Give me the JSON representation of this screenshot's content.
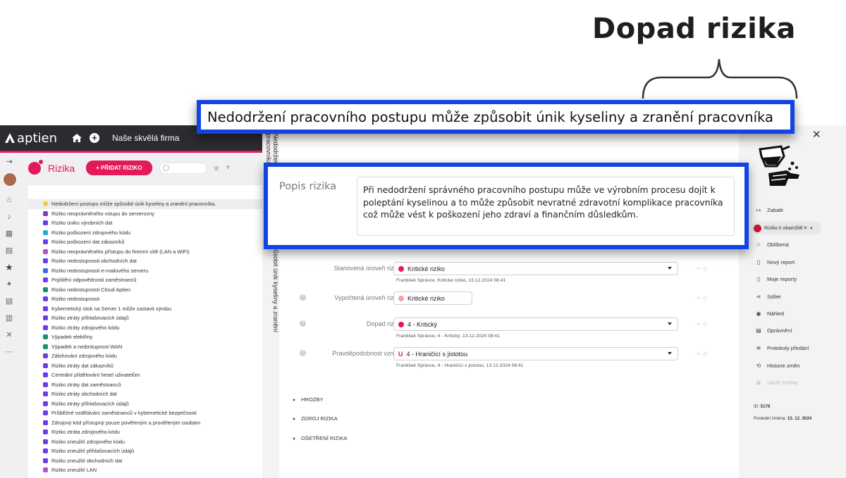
{
  "headline": "Dopad rizika",
  "callout_title": "Nedodržení pracovního postupu může způsobit únik kyseliny a zranění pracovníka",
  "description": {
    "label": "Popis rizika",
    "text": "Při nedodržení správného pracovního postupu může ve výrobním procesu dojít k poleptání kyselinou a to může způsobit nevratné zdravotní komplikace pracovníka což může vést k poškození jeho zdraví a finančním důsledkům."
  },
  "app": {
    "logo_text": "aptien",
    "company": "Naše skvělá firma",
    "section_title": "Rizika",
    "add_button": "+ PŘIDAT RIZIKO",
    "accent": "#e3195a"
  },
  "risk_list": [
    {
      "label": "Nedodržení postupu může způsobit únik kyseliny a zranění pracovníka.",
      "color": "#f5c542",
      "active": true
    },
    {
      "label": "Riziko neoprávněného vstupu do serverovny",
      "color": "#8a3ab9"
    },
    {
      "label": "Riziko úniku výrobních dat",
      "color": "#6a3de8"
    },
    {
      "label": "Riziko poškození zdrojového kódu",
      "color": "#2aa7d6"
    },
    {
      "label": "Riziko poškození dat zákazníků",
      "color": "#6a3de8"
    },
    {
      "label": "Riziko neoprávněného přístupu do firemní sítě (LAN a WiFi)",
      "color": "#b14fd6"
    },
    {
      "label": "Riziko nedostupnosti obchodních dat",
      "color": "#6a3de8"
    },
    {
      "label": "Riziko nedostupnosti e-mailového serveru",
      "color": "#3b6fd8"
    },
    {
      "label": "Pojištění odpovědnosti zaměstnanců",
      "color": "#6a3de8"
    },
    {
      "label": "Riziko nedostupnosti Cloud Aptien",
      "color": "#1a8f6f"
    },
    {
      "label": "Riziko nedostupnosti",
      "color": "#6a3de8"
    },
    {
      "label": "Kybernetický útok na Server 1 může zastavit výrobu",
      "color": "#6a3de8"
    },
    {
      "label": "Riziko ztráty přihlašovacích údajů",
      "color": "#6a3de8"
    },
    {
      "label": "Riziko ztráty zdrojového kódu",
      "color": "#6a3de8"
    },
    {
      "label": "Výpadek elektřiny",
      "color": "#1a8f6f"
    },
    {
      "label": "Výpadek a nedostupnost WAN",
      "color": "#1a8f6f"
    },
    {
      "label": "Zálohování zdrojového kódu",
      "color": "#6a3de8"
    },
    {
      "label": "Riziko ztráty dat zákazníků",
      "color": "#6a3de8"
    },
    {
      "label": "Centrální přidělování hesel uživatelům",
      "color": "#6a3de8"
    },
    {
      "label": "Riziko ztráty dat zaměstnanců",
      "color": "#6a3de8"
    },
    {
      "label": "Riziko ztráty obchodních dat",
      "color": "#6a3de8"
    },
    {
      "label": "Riziko ztráty přihlašovacích údajů",
      "color": "#6a3de8"
    },
    {
      "label": "Průběžné vzdělávání zaměstnanců v kybernetické bezpečnosti",
      "color": "#6a3de8"
    },
    {
      "label": "Zdrojový kód přístupný pouze pověřeným a prověřeným osobám",
      "color": "#6a3de8"
    },
    {
      "label": "Riziko ztráta zdrojového kódu",
      "color": "#6a3de8"
    },
    {
      "label": "Riziko zneužití zdrojového kódu",
      "color": "#6a3de8"
    },
    {
      "label": "Riziko zneužití přihlašovacích údajů",
      "color": "#6a3de8"
    },
    {
      "label": "Riziko zneužití obchodních dat",
      "color": "#6a3de8"
    },
    {
      "label": "Riziko zneužití LAN",
      "color": "#b14fd6"
    }
  ],
  "detail": {
    "vertical_title": "Nedodržení pracovního postupu může způsobit únik kyseliny a zranění pracovníka.",
    "fields": [
      {
        "label": "Stanovená úroveň rizika",
        "value": "Kritické riziko",
        "dot": "#e3195a",
        "meta": "František Správce, Kritické riziko, 13.12.2024 08:41",
        "help": false,
        "select": true
      },
      {
        "label": "Vypočtená úroveň rizika",
        "value": "Kritické riziko",
        "dot": "#f2a3a8",
        "meta": "",
        "help": true,
        "select": false
      },
      {
        "label": "Dopad rizika",
        "value": "4 - Kritický",
        "dot": "#e3195a",
        "meta": "František Správce, 4 - Kritický, 13.12.2024 08:41",
        "help": true,
        "select": true
      },
      {
        "label": "Pravděpodobnost vzniku",
        "value": "4 - Hraničící s jistotou",
        "dot": "magnet",
        "meta": "František Správce, 4 - Hraničící s jistotou, 13.12.2024 08:41",
        "help": true,
        "select": true
      }
    ],
    "sections": [
      "HROZBY",
      "ZDROJ RIZIKA",
      "OŠETŘENÍ RIZIKA"
    ]
  },
  "actions": {
    "collapse": "Zabalit",
    "status_pill": "Riziko k okamžitě",
    "items": [
      {
        "label": "Oblíbená",
        "icon": "star-outline-icon",
        "disabled": false
      },
      {
        "label": "Nový report",
        "icon": "report-icon",
        "disabled": false
      },
      {
        "label": "Moje reporty",
        "icon": "reports-icon",
        "disabled": false
      },
      {
        "label": "Sdílet",
        "icon": "share-icon",
        "disabled": false
      },
      {
        "label": "Náhled",
        "icon": "eye-icon",
        "disabled": false
      },
      {
        "label": "Oprávnění",
        "icon": "permissions-icon",
        "disabled": false
      },
      {
        "label": "Protokoly předání",
        "icon": "handover-icon",
        "disabled": false
      },
      {
        "label": "Historie změn",
        "icon": "history-icon",
        "disabled": false
      },
      {
        "label": "Uložit změny",
        "icon": "save-icon",
        "disabled": true
      }
    ],
    "id_label": "ID:",
    "id_value": "5176",
    "last_change_label": "Poslední změna:",
    "last_change_value": "13. 12. 2024"
  }
}
